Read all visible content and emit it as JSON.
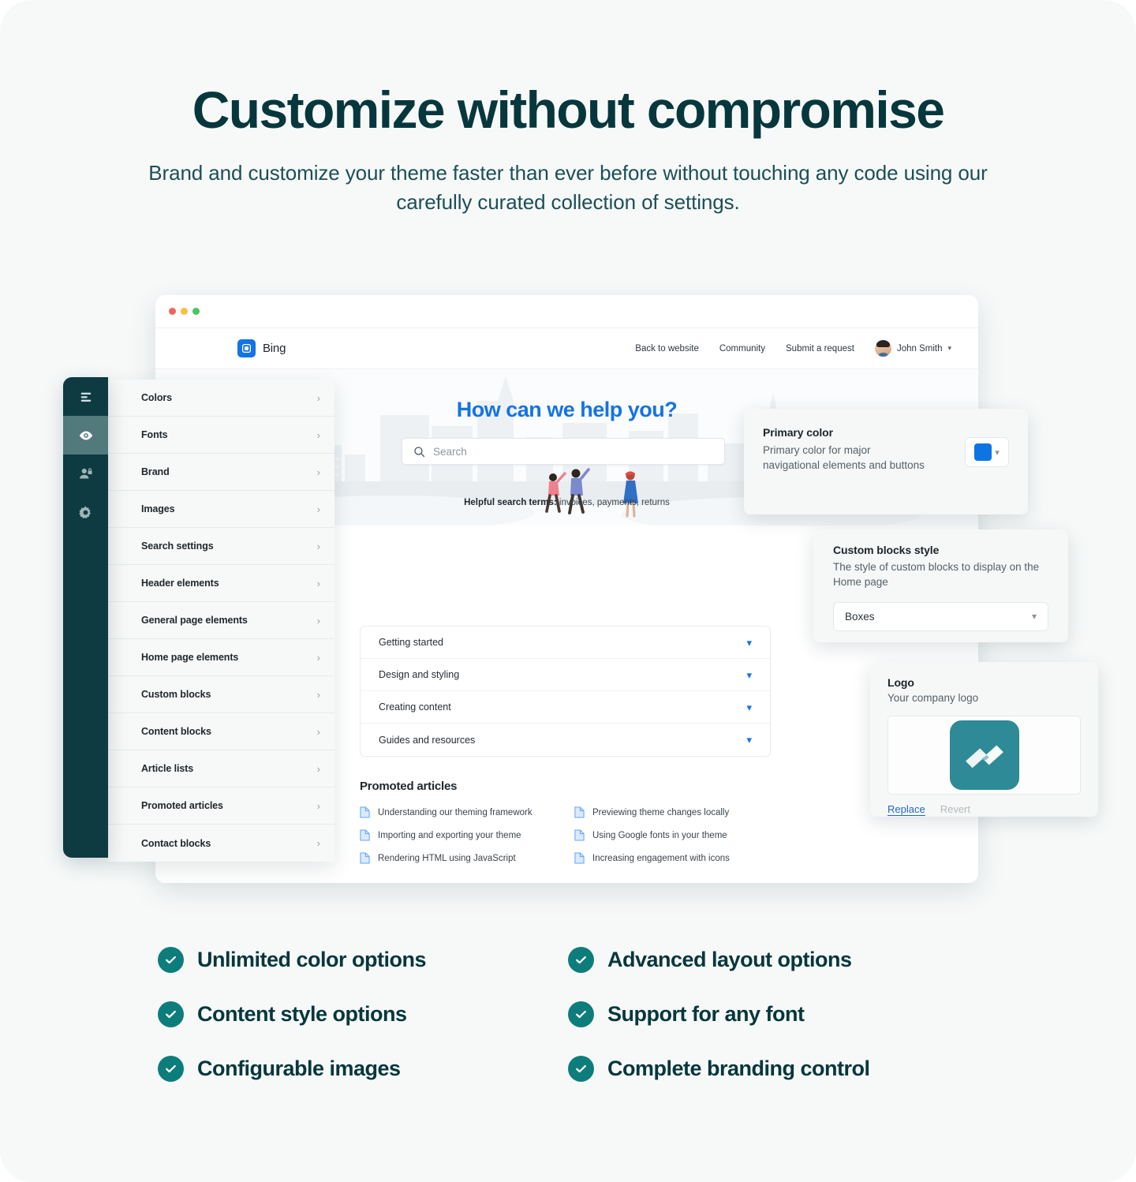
{
  "hero": {
    "title": "Customize without compromise",
    "subtitle": "Brand and customize your theme faster than ever before without touching any code using our carefully curated collection of settings."
  },
  "browser": {
    "site_header": {
      "brand_name": "Bing",
      "nav": [
        {
          "label": "Back to website"
        },
        {
          "label": "Community"
        },
        {
          "label": "Submit a request"
        }
      ],
      "user_name": "John Smith"
    },
    "site_hero": {
      "question": "How can we help you?",
      "search_placeholder": "Search",
      "terms_label": "Helpful search terms:",
      "terms": "invoices,  payments,  returns"
    },
    "accordion": [
      {
        "label": "Getting started"
      },
      {
        "label": "Design and styling"
      },
      {
        "label": "Creating content"
      },
      {
        "label": "Guides and resources"
      }
    ],
    "promoted": {
      "title": "Promoted articles",
      "items": [
        {
          "label": "Understanding our theming framework"
        },
        {
          "label": "Previewing theme changes locally"
        },
        {
          "label": "Importing and exporting your theme"
        },
        {
          "label": "Using Google fonts in your theme"
        },
        {
          "label": "Rendering HTML using JavaScript"
        },
        {
          "label": "Increasing engagement with icons"
        }
      ]
    }
  },
  "rail": {
    "items": [
      {
        "icon": "menu-icon",
        "active": false
      },
      {
        "icon": "eye-icon",
        "active": true
      },
      {
        "icon": "user-lock-icon",
        "active": false
      },
      {
        "icon": "gear-icon",
        "active": false
      }
    ]
  },
  "settings_menu": [
    {
      "label": "Colors"
    },
    {
      "label": "Fonts"
    },
    {
      "label": "Brand"
    },
    {
      "label": "Images"
    },
    {
      "label": "Search settings"
    },
    {
      "label": "Header elements"
    },
    {
      "label": "General page elements"
    },
    {
      "label": "Home page elements"
    },
    {
      "label": "Custom blocks"
    },
    {
      "label": "Content blocks"
    },
    {
      "label": "Article lists"
    },
    {
      "label": "Promoted articles"
    },
    {
      "label": "Contact blocks"
    }
  ],
  "cards": {
    "primary_color": {
      "title": "Primary color",
      "description": "Primary color for major navigational elements and buttons",
      "value": "#0B75E3"
    },
    "custom_blocks_style": {
      "title": "Custom blocks style",
      "description": "The style of custom blocks to display on the Home page",
      "selected": "Boxes"
    },
    "logo": {
      "title": "Logo",
      "description": "Your company logo",
      "replace_label": "Replace",
      "revert_label": "Revert"
    }
  },
  "features": [
    {
      "label": "Unlimited color options"
    },
    {
      "label": "Advanced layout options"
    },
    {
      "label": "Content style options"
    },
    {
      "label": "Support for any font"
    },
    {
      "label": "Configurable images"
    },
    {
      "label": "Complete branding control"
    }
  ],
  "colors": {
    "accent_teal": "#0D7D7B",
    "dark_teal": "#0D3B41",
    "brand_blue": "#1473E6",
    "heading": "#06373C"
  }
}
